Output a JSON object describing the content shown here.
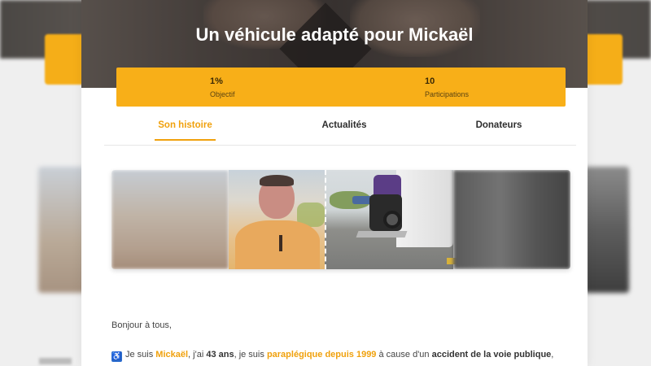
{
  "hero": {
    "title": "Un véhicule adapté pour Mickaël"
  },
  "stats": {
    "objective_value": "1%",
    "objective_label": "Objectif",
    "participations_value": "10",
    "participations_label": "Participations",
    "accent_color": "#f8af18"
  },
  "tabs": [
    {
      "label": "Son histoire",
      "active": true
    },
    {
      "label": "Actualités",
      "active": false
    },
    {
      "label": "Donateurs",
      "active": false
    }
  ],
  "story": {
    "greeting": "Bonjour à tous,",
    "line2": {
      "icon": "wheelchair-icon",
      "seg1": "Je suis ",
      "name": "Mickaël",
      "seg2": ", j'ai ",
      "age": "43 ans",
      "seg3": ", je suis ",
      "condition": "paraplégique depuis 1999",
      "seg4": " à cause d'un ",
      "cause": "accident de la voie publique",
      "seg5": ","
    }
  }
}
